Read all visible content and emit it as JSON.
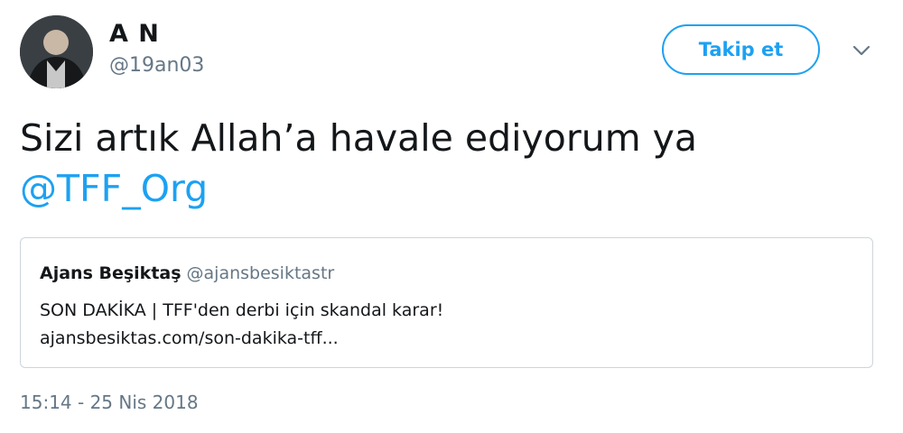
{
  "user": {
    "display_name": "A N",
    "handle": "@19an03",
    "avatar": "profile-photo"
  },
  "follow_button": {
    "label": "Takip et"
  },
  "menu": {
    "icon": "chevron-down-icon"
  },
  "tweet": {
    "text_line": "Sizi artık Allah’a havale ediyorum ya",
    "mention": "@TFF_Org"
  },
  "quoted_tweet": {
    "name": "Ajans Beşiktaş",
    "handle": "@ajansbesiktastr",
    "text_line1": "SON DAKİKA | TFF'den derbi için skandal karar!",
    "text_line2": "ajansbesiktas.com/son-dakika-tff..."
  },
  "timestamp": "15:14 - 25 Nis 2018",
  "colors": {
    "accent": "#1da1f2",
    "text": "#14171a",
    "muted": "#657786",
    "border": "#ccd6dd"
  }
}
